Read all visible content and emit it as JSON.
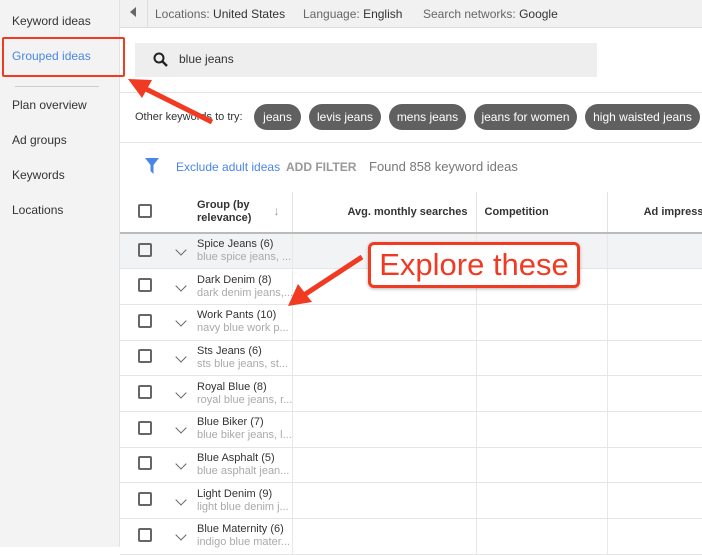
{
  "sidebar": {
    "items": [
      {
        "label": "Keyword ideas"
      },
      {
        "label": "Grouped ideas",
        "active": true
      },
      {
        "label": "Plan overview"
      },
      {
        "label": "Ad groups"
      },
      {
        "label": "Keywords"
      },
      {
        "label": "Locations"
      }
    ]
  },
  "topbar": {
    "locations_label": "Locations:",
    "locations_value": "United States",
    "language_label": "Language:",
    "language_value": "English",
    "networks_label": "Search networks:",
    "networks_value": "Google"
  },
  "search": {
    "value": "blue jeans",
    "icon": "search-icon"
  },
  "suggestions": {
    "label": "Other keywords to try:",
    "chips": [
      "jeans",
      "levis jeans",
      "mens jeans",
      "jeans for women",
      "high waisted jeans"
    ]
  },
  "filters": {
    "icon": "filter-icon",
    "exclude": "Exclude adult ideas",
    "add": "ADD FILTER",
    "found": "Found 858 keyword ideas"
  },
  "table": {
    "headers": {
      "group": "Group (by relevance)",
      "avg": "Avg. monthly searches",
      "competition": "Competition",
      "impr": "Ad impression"
    },
    "rows": [
      {
        "name": "Spice Jeans (6)",
        "sub": "blue spice jeans, ..."
      },
      {
        "name": "Dark Denim (8)",
        "sub": "dark denim jeans,..."
      },
      {
        "name": "Work Pants (10)",
        "sub": "navy blue work p..."
      },
      {
        "name": "Sts Jeans (6)",
        "sub": "sts blue jeans, st..."
      },
      {
        "name": "Royal Blue (8)",
        "sub": "royal blue jeans, r..."
      },
      {
        "name": "Blue Biker (7)",
        "sub": "blue biker jeans, l..."
      },
      {
        "name": "Blue Asphalt (5)",
        "sub": "blue asphalt jean..."
      },
      {
        "name": "Light Denim (9)",
        "sub": "light blue denim j..."
      },
      {
        "name": "Blue Maternity (6)",
        "sub": "indigo blue mater..."
      }
    ]
  },
  "annotation": {
    "callout": "Explore these",
    "color": "#f03a22"
  },
  "colors": {
    "accent": "#4a86e8",
    "chip": "#606060"
  }
}
